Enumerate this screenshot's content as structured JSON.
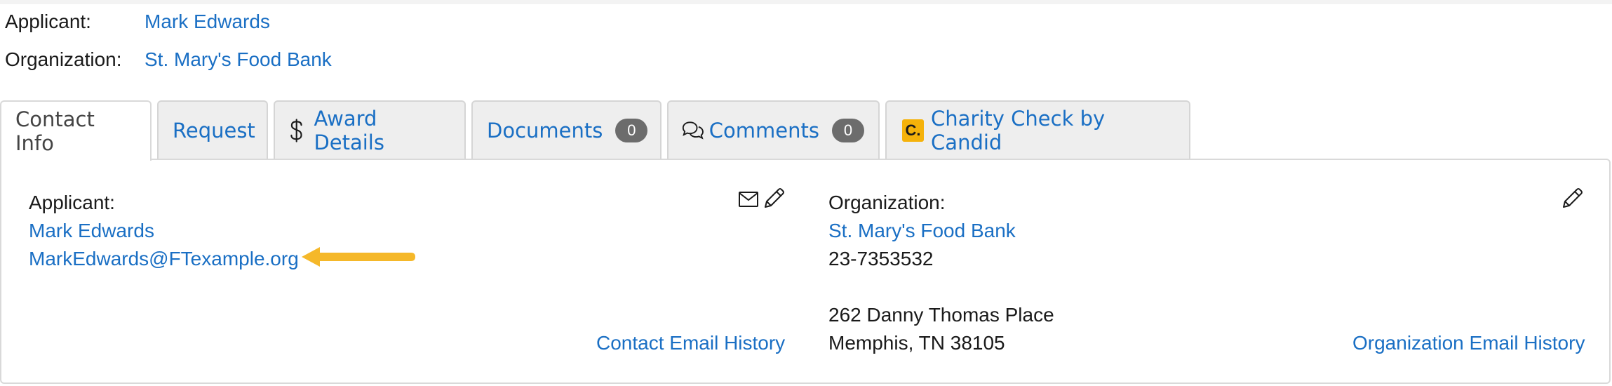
{
  "header": {
    "applicant_label": "Applicant:",
    "applicant_name": "Mark Edwards",
    "organization_label": "Organization:",
    "organization_name": "St. Mary's Food Bank"
  },
  "tabs": [
    {
      "label": "Contact Info",
      "active": true
    },
    {
      "label": "Request"
    },
    {
      "label": "Award Details",
      "icon": "dollar-icon"
    },
    {
      "label": "Documents",
      "badge": "0"
    },
    {
      "label": "Comments",
      "badge": "0",
      "icon": "comments-icon"
    },
    {
      "label": "Charity Check by Candid",
      "icon": "candid-logo-icon",
      "icon_text": "C."
    }
  ],
  "contact": {
    "applicant_label": "Applicant:",
    "applicant_name": "Mark Edwards",
    "applicant_email": "MarkEdwards@FTexample.org",
    "email_history_link": "Contact Email History",
    "organization_label": "Organization:",
    "organization_name": "St. Mary's Food Bank",
    "organization_ein": "23-7353532",
    "address_line1": "262 Danny Thomas Place",
    "address_line2": "Memphis, TN 38105",
    "org_email_history_link": "Organization Email History"
  },
  "colors": {
    "link": "#1a6fc4",
    "tab_background": "#eeeeee",
    "badge": "#6c6c6c",
    "annotation_arrow": "#f5b82a"
  }
}
